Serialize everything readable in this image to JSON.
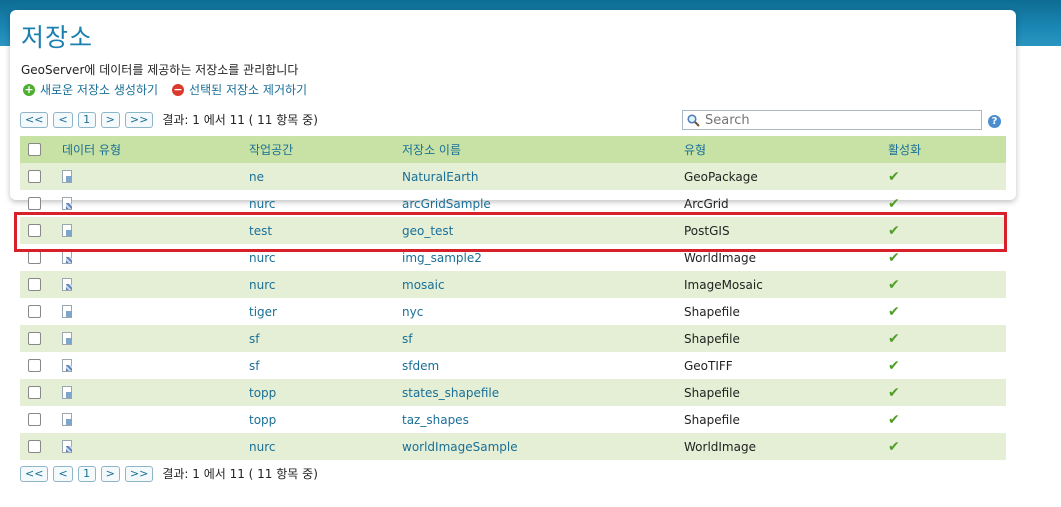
{
  "page": {
    "title": "저장소",
    "description": "GeoServer에 데이터를 제공하는 저장소를 관리합니다",
    "add_label": "새로운 저장소 생성하기",
    "remove_label": "선택된 저장소 제거하기"
  },
  "pager": {
    "first": "<<",
    "prev": "<",
    "current": "1",
    "next": ">",
    "last": ">>",
    "info": "결과: 1 에서 11 ( 11 항목 중)"
  },
  "search": {
    "placeholder": "Search"
  },
  "table": {
    "headers": {
      "data_type": "데이터 유형",
      "workspace": "작업공간",
      "store_name": "저장소 이름",
      "type": "유형",
      "enabled": "활성화"
    },
    "rows": [
      {
        "icon": "vector-store-icon",
        "workspace": "ne",
        "name": "NaturalEarth",
        "type": "GeoPackage",
        "enabled": "✔"
      },
      {
        "icon": "raster-store-icon",
        "workspace": "nurc",
        "name": "arcGridSample",
        "type": "ArcGrid",
        "enabled": "✔"
      },
      {
        "icon": "vector-store-icon",
        "workspace": "test",
        "name": "geo_test",
        "type": "PostGIS",
        "enabled": "✔"
      },
      {
        "icon": "raster-store-icon",
        "workspace": "nurc",
        "name": "img_sample2",
        "type": "WorldImage",
        "enabled": "✔"
      },
      {
        "icon": "raster-store-icon",
        "workspace": "nurc",
        "name": "mosaic",
        "type": "ImageMosaic",
        "enabled": "✔"
      },
      {
        "icon": "vector-store-icon",
        "workspace": "tiger",
        "name": "nyc",
        "type": "Shapefile",
        "enabled": "✔"
      },
      {
        "icon": "vector-store-icon",
        "workspace": "sf",
        "name": "sf",
        "type": "Shapefile",
        "enabled": "✔"
      },
      {
        "icon": "raster-store-icon",
        "workspace": "sf",
        "name": "sfdem",
        "type": "GeoTIFF",
        "enabled": "✔"
      },
      {
        "icon": "vector-store-icon",
        "workspace": "topp",
        "name": "states_shapefile",
        "type": "Shapefile",
        "enabled": "✔"
      },
      {
        "icon": "vector-store-icon",
        "workspace": "topp",
        "name": "taz_shapes",
        "type": "Shapefile",
        "enabled": "✔"
      },
      {
        "icon": "raster-store-icon",
        "workspace": "nurc",
        "name": "worldImageSample",
        "type": "WorldImage",
        "enabled": "✔"
      }
    ]
  },
  "colors": {
    "accent": "#1b7fb0",
    "header_bg": "#c8e2a5",
    "alt_row": "#e4efd5",
    "highlight": "#d8202a"
  }
}
